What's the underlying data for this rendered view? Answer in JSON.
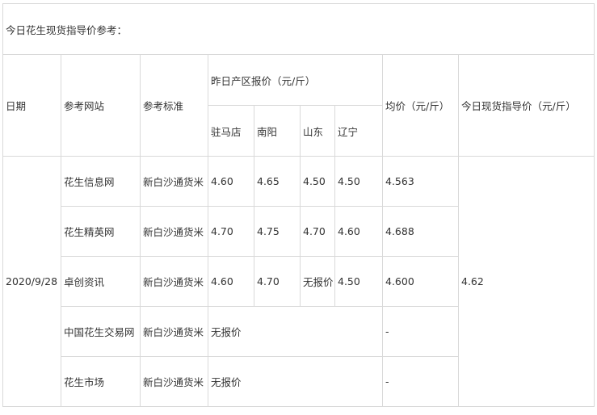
{
  "title": "今日花生现货指导价参考：",
  "headers": {
    "date": "日期",
    "site": "参考网站",
    "standard": "参考标准",
    "group": "昨日产区报价（元/斤）",
    "regions": [
      "驻马店",
      "南阳",
      "山东",
      "辽宁"
    ],
    "avg": "均价（元/斤）",
    "guide": "今日现货指导价（元/斤）"
  },
  "date": "2020/9/28",
  "guide_price": "4.62",
  "rows": [
    {
      "site": "花生信息网",
      "standard": "新白沙通货米",
      "prices": [
        "4.60",
        "4.65",
        "4.50",
        "4.50"
      ],
      "avg": "4.563"
    },
    {
      "site": "花生精英网",
      "standard": "新白沙通货米",
      "prices": [
        "4.70",
        "4.75",
        "4.70",
        "4.60"
      ],
      "avg": "4.688"
    },
    {
      "site": "卓创资讯",
      "standard": "新白沙通货米",
      "prices": [
        "4.60",
        "4.70",
        "无报价",
        "4.50"
      ],
      "avg": "4.600"
    },
    {
      "site": "中国花生交易网",
      "standard": "新白沙通货米",
      "no_quote": "无报价",
      "avg": "-"
    },
    {
      "site": "花生市场",
      "standard": "新白沙通货米",
      "no_quote": "无报价",
      "avg": "-"
    }
  ]
}
